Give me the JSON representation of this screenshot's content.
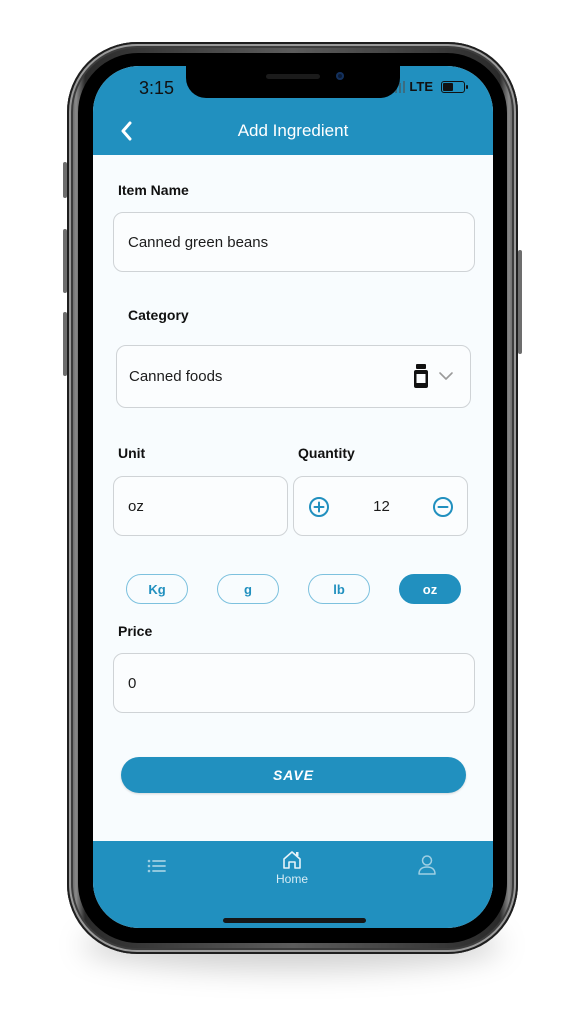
{
  "status_bar": {
    "time": "3:15",
    "network": "LTE"
  },
  "header": {
    "title": "Add Ingredient",
    "back_icon": "chevron-left-icon"
  },
  "form": {
    "item_name": {
      "label": "Item Name",
      "value": "Canned green beans"
    },
    "category": {
      "label": "Category",
      "value": "Canned foods",
      "icon": "jar-icon",
      "dropdown_icon": "chevron-down-icon"
    },
    "unit": {
      "label": "Unit",
      "value": "oz"
    },
    "quantity": {
      "label": "Quantity",
      "value": "12",
      "increment_icon": "plus-circle-icon",
      "decrement_icon": "minus-circle-icon"
    },
    "unit_chips": [
      {
        "label": "Kg",
        "selected": false
      },
      {
        "label": "g",
        "selected": false
      },
      {
        "label": "lb",
        "selected": false
      },
      {
        "label": "oz",
        "selected": true
      }
    ],
    "price": {
      "label": "Price",
      "value": "0"
    },
    "save_label": "SAVE"
  },
  "bottom_nav": {
    "items": [
      {
        "label": "",
        "icon": "list-icon"
      },
      {
        "label": "Home",
        "icon": "home-icon"
      },
      {
        "label": "",
        "icon": "user-icon"
      }
    ]
  },
  "colors": {
    "primary": "#2190bf",
    "background": "#f8fcfe",
    "chip_border": "#7dc1de"
  }
}
